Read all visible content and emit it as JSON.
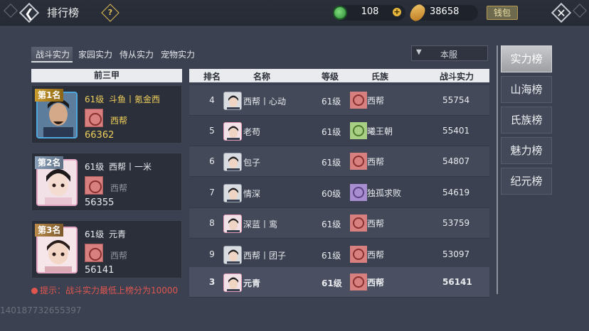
{
  "header": {
    "title": "排行榜",
    "help_glyph": "?",
    "jade_value": "108",
    "coin_value": "38658",
    "wallet_label": "钱包"
  },
  "category_tabs": [
    {
      "label": "战斗实力",
      "active": true
    },
    {
      "label": "家园实力",
      "active": false
    },
    {
      "label": "侍从实力",
      "active": false
    },
    {
      "label": "宠物实力",
      "active": false
    }
  ],
  "server_select": {
    "value": "本服"
  },
  "top3": {
    "header": "前三甲",
    "cards": [
      {
        "badge": "第1名",
        "level": "61级",
        "name": "斗鱼丨氪金西",
        "clan": "西帮",
        "score": "66362"
      },
      {
        "badge": "第2名",
        "level": "61级",
        "name": "西帮丨一米",
        "clan": "西帮",
        "score": "56355"
      },
      {
        "badge": "第3名",
        "level": "61级",
        "name": "元青",
        "clan": "西帮",
        "score": "56141"
      }
    ]
  },
  "hint": "提示：战斗实力最低上榜分为10000",
  "watermark": "140187732655397",
  "table": {
    "columns": [
      "排名",
      "名称",
      "等级",
      "氏族",
      "战斗实力"
    ],
    "rows": [
      {
        "rank": "4",
        "name": "西帮丨心动",
        "level": "61级",
        "clan": "西帮",
        "score": "55754"
      },
      {
        "rank": "5",
        "name": "老苟",
        "level": "61级",
        "clan": "曦王朝",
        "score": "55401"
      },
      {
        "rank": "6",
        "name": "包子",
        "level": "61级",
        "clan": "西帮",
        "score": "54807"
      },
      {
        "rank": "7",
        "name": "情深",
        "level": "60级",
        "clan": "独孤求败",
        "score": "54619"
      },
      {
        "rank": "8",
        "name": "深蓝丨鸾",
        "level": "61级",
        "clan": "西帮",
        "score": "53759"
      },
      {
        "rank": "9",
        "name": "西帮丨团子",
        "level": "61级",
        "clan": "西帮",
        "score": "53097"
      }
    ],
    "mine": {
      "rank": "3",
      "name": "元青",
      "level": "61级",
      "clan": "西帮",
      "score": "56141"
    }
  },
  "side_tabs": [
    {
      "label": "实力榜",
      "active": true
    },
    {
      "label": "山海榜",
      "active": false
    },
    {
      "label": "氏族榜",
      "active": false
    },
    {
      "label": "魅力榜",
      "active": false
    },
    {
      "label": "纪元榜",
      "active": false
    }
  ]
}
